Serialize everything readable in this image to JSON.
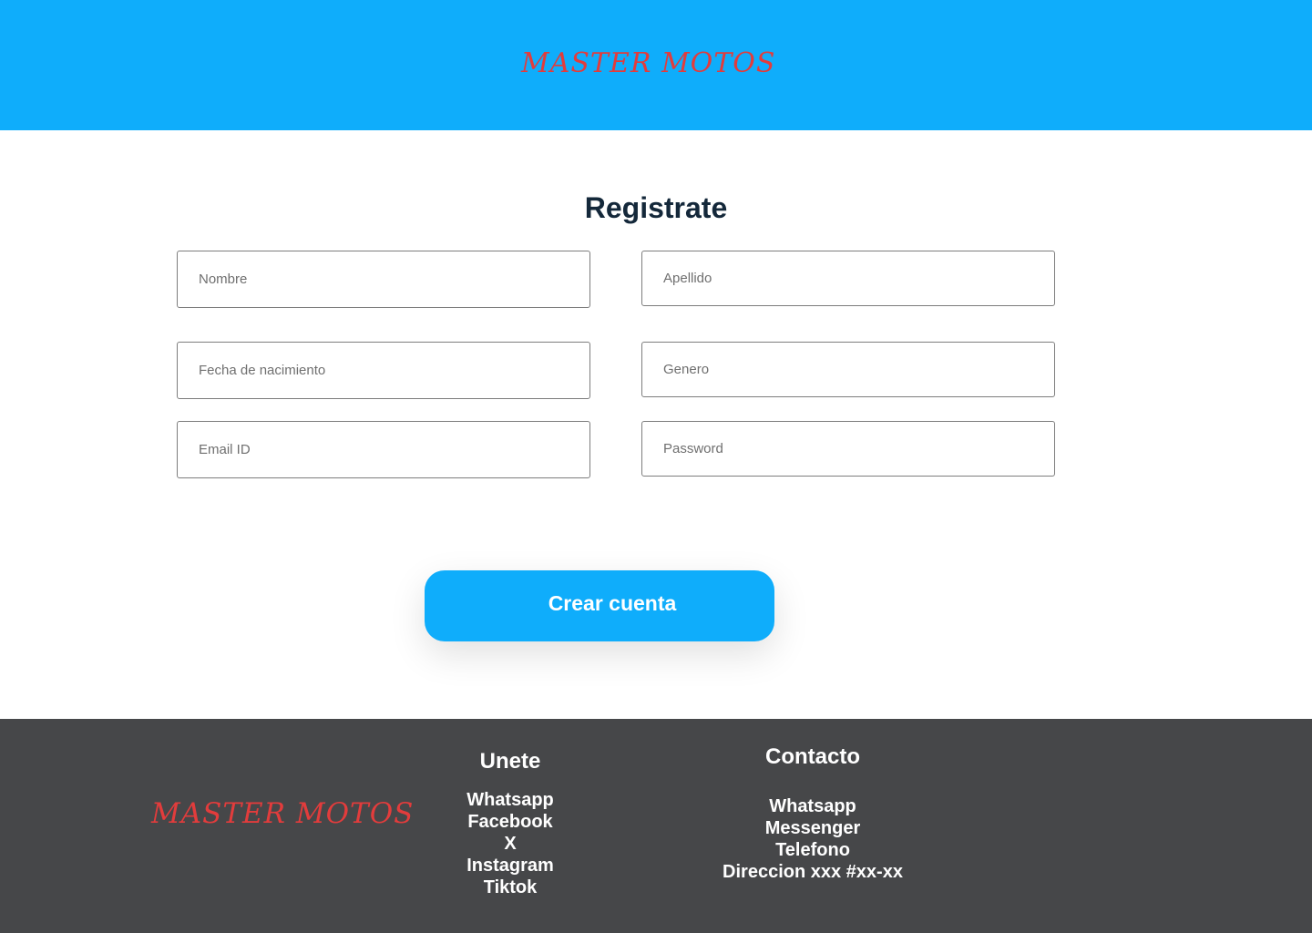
{
  "header": {
    "brand": "MASTER MOTOS",
    "background": "#0fadfb",
    "brand_color": "#e23c3c"
  },
  "form": {
    "title": "Registrate",
    "fields": {
      "nombre": {
        "placeholder": "Nombre",
        "value": ""
      },
      "apellido": {
        "placeholder": "Apellido",
        "value": ""
      },
      "fecha_nacimiento": {
        "placeholder": "Fecha de nacimiento",
        "value": ""
      },
      "genero": {
        "placeholder": "Genero",
        "value": ""
      },
      "email": {
        "placeholder": "Email ID",
        "value": ""
      },
      "password": {
        "placeholder": "Password",
        "value": ""
      }
    },
    "submit_label": "Crear cuenta"
  },
  "footer": {
    "brand": "MASTER MOTOS",
    "background": "#464749",
    "unete": {
      "title": "Unete",
      "links": [
        "Whatsapp",
        "Facebook",
        "X",
        "Instagram",
        "Tiktok"
      ]
    },
    "contacto": {
      "title": "Contacto",
      "links": [
        "Whatsapp",
        "Messenger",
        "Telefono",
        "Direccion xxx #xx-xx"
      ]
    }
  }
}
